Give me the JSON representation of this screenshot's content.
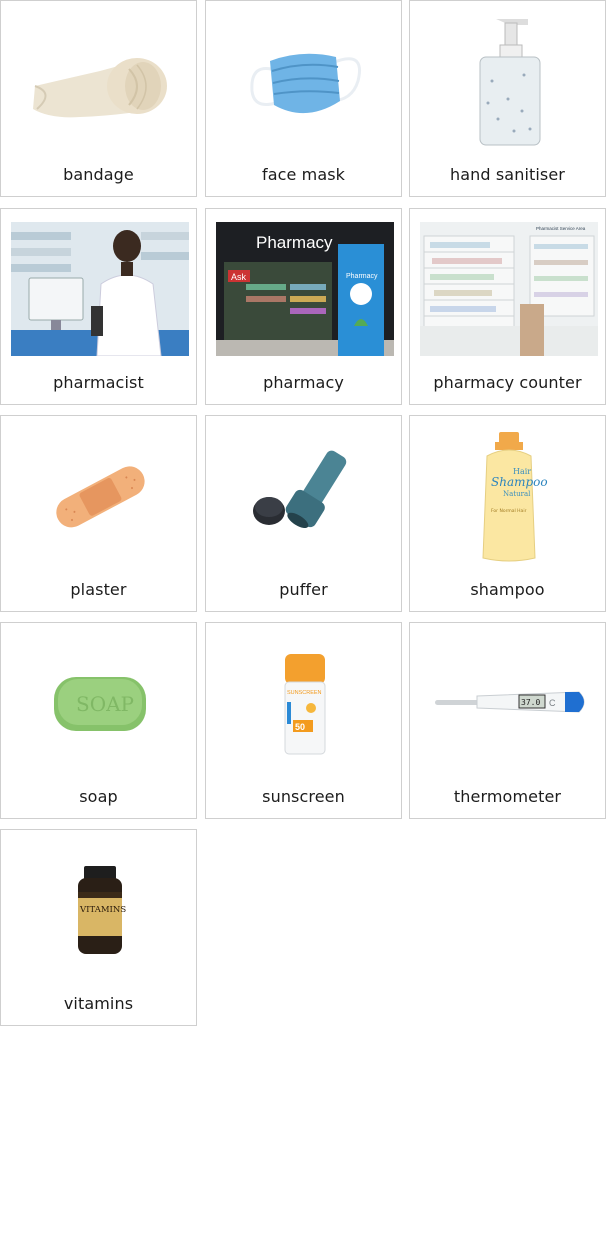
{
  "cards": [
    {
      "label": "bandage",
      "icon": "bandage-icon"
    },
    {
      "label": "face mask",
      "icon": "face-mask-icon"
    },
    {
      "label": "hand sanitiser",
      "icon": "hand-sanitiser-icon"
    },
    {
      "label": "pharmacist",
      "icon": "pharmacist-photo"
    },
    {
      "label": "pharmacy",
      "icon": "pharmacy-storefront-photo",
      "sign_text": "Pharmacy",
      "door_text": "Ask",
      "poster_text": "Pharmacy"
    },
    {
      "label": "pharmacy counter",
      "icon": "pharmacy-counter-photo",
      "sign_text": "Pharmacist Service Area"
    },
    {
      "label": "plaster",
      "icon": "plaster-icon"
    },
    {
      "label": "puffer",
      "icon": "puffer-icon"
    },
    {
      "label": "shampoo",
      "icon": "shampoo-icon",
      "bottle_top": "Hair",
      "bottle_brand": "Shampoo",
      "bottle_sub": "Natural",
      "bottle_small": "For Normal Hair"
    },
    {
      "label": "soap",
      "icon": "soap-icon",
      "bar_text": "SOAP"
    },
    {
      "label": "sunscreen",
      "icon": "sunscreen-icon",
      "bottle_brand": "SUNSCREEN",
      "spf": "50"
    },
    {
      "label": "thermometer",
      "icon": "thermometer-icon",
      "reading": "37.0",
      "unit": "C"
    },
    {
      "label": "vitamins",
      "icon": "vitamins-icon",
      "jar_text": "VITAMINS"
    }
  ],
  "colors": {
    "border": "#cfcfcf",
    "text": "#1c1c1c"
  }
}
